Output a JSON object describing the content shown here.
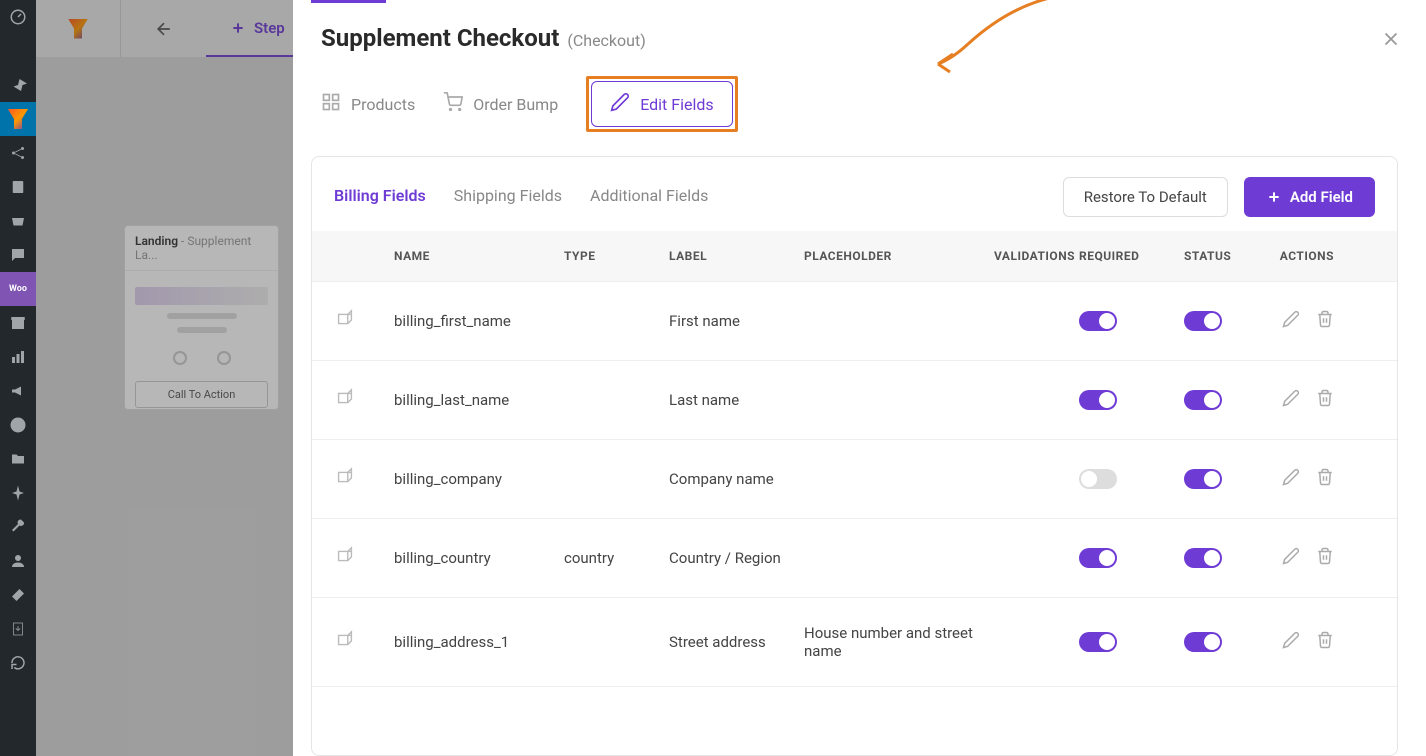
{
  "colors": {
    "accent": "#6f3bd5",
    "annotation": "#e67e22"
  },
  "admin_sidebar": [
    "dashboard",
    "brush",
    "pin",
    "funnel",
    "share",
    "book",
    "store",
    "chat",
    "woo",
    "archive",
    "chart",
    "megaphone",
    "elementor",
    "folder",
    "pin2",
    "wrench",
    "user",
    "tool",
    "import",
    "refresh"
  ],
  "bg": {
    "tab_label": "Step",
    "landing_title": "Landing",
    "landing_subtitle": " - Supplement La...",
    "cta": "Call To Action"
  },
  "panel": {
    "title": "Supplement Checkout",
    "subtitle": "(Checkout)"
  },
  "top_tabs": {
    "products": "Products",
    "order_bump": "Order Bump",
    "edit_fields": "Edit Fields"
  },
  "sub_tabs": {
    "billing": "Billing Fields",
    "shipping": "Shipping Fields",
    "additional": "Additional Fields"
  },
  "buttons": {
    "restore": "Restore To Default",
    "add_field": "Add Field"
  },
  "table": {
    "headers": {
      "name": "NAME",
      "type": "TYPE",
      "label": "LABEL",
      "placeholder": "PLACEHOLDER",
      "validations": "VALIDATIONS",
      "required": "REQUIRED",
      "status": "STATUS",
      "actions": "ACTIONS"
    },
    "rows": [
      {
        "name": "billing_first_name",
        "type": "",
        "label": "First name",
        "placeholder": "",
        "required": true,
        "status": true
      },
      {
        "name": "billing_last_name",
        "type": "",
        "label": "Last name",
        "placeholder": "",
        "required": true,
        "status": true
      },
      {
        "name": "billing_company",
        "type": "",
        "label": "Company name",
        "placeholder": "",
        "required": false,
        "status": true
      },
      {
        "name": "billing_country",
        "type": "country",
        "label": "Country / Region",
        "placeholder": "",
        "required": true,
        "status": true
      },
      {
        "name": "billing_address_1",
        "type": "",
        "label": "Street address",
        "placeholder": "House number and street name",
        "required": true,
        "status": true
      }
    ]
  }
}
